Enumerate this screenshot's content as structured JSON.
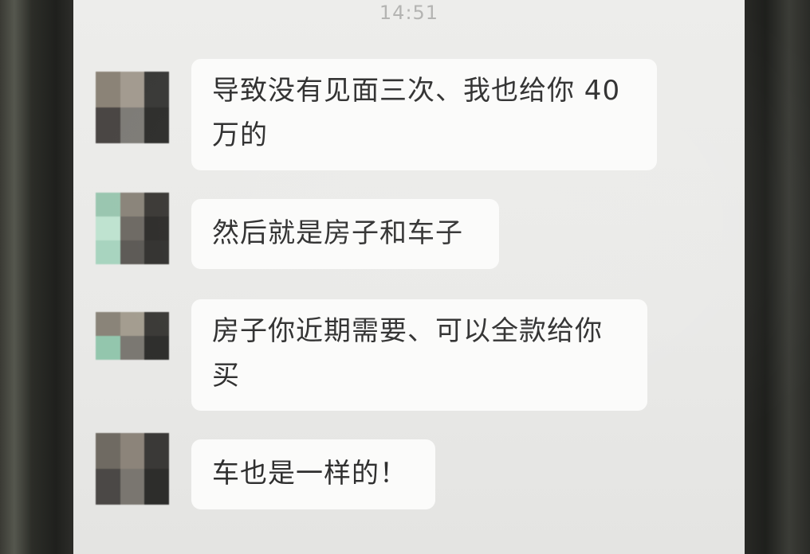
{
  "status": {
    "time": "14:51"
  },
  "messages": [
    {
      "sender": "contact",
      "text": "导致没有见面三次、我也给你 40\n万的"
    },
    {
      "sender": "contact",
      "text": "然后就是房子和车子"
    },
    {
      "sender": "contact",
      "text": "房子你近期需要、可以全款给你\n买"
    },
    {
      "sender": "contact",
      "text": "车也是一样的！"
    }
  ],
  "colors": {
    "screen_bg": "#ebebe9",
    "bubble_bg": "#fbfbfa",
    "text": "#2f2f2f",
    "timestamp": "#b3b3b1"
  }
}
